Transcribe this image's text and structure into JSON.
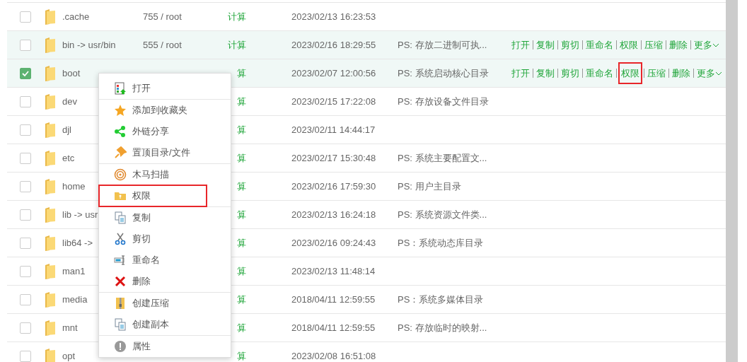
{
  "rows": [
    {
      "name": ".cache",
      "perms": "755 / root",
      "size": "计算",
      "date": "2023/02/13 16:23:53",
      "checked": false,
      "highlighted": false
    },
    {
      "name": "bin -> usr/bin",
      "perms": "555 / root",
      "size": "计算",
      "date": "2023/02/16 18:29:55",
      "note": "PS: 存放二进制可执...",
      "checked": false,
      "highlighted": true,
      "actions": [
        {
          "label": "打开",
          "marked": false
        },
        {
          "label": "复制",
          "marked": false
        },
        {
          "label": "剪切",
          "marked": false
        },
        {
          "label": "重命名",
          "marked": false
        },
        {
          "label": "权限",
          "marked": false
        },
        {
          "label": "压缩",
          "marked": false
        },
        {
          "label": "删除",
          "marked": false
        },
        {
          "label": "更多",
          "marked": false,
          "dropdown": true
        }
      ]
    },
    {
      "name": "boot",
      "size": "算",
      "date": "2023/02/07 12:00:56",
      "note": "PS: 系统启动核心目录",
      "checked": true,
      "highlighted": true,
      "actions": [
        {
          "label": "打开",
          "marked": false
        },
        {
          "label": "复制",
          "marked": false
        },
        {
          "label": "剪切",
          "marked": false
        },
        {
          "label": "重命名",
          "marked": false
        },
        {
          "label": "权限",
          "marked": true
        },
        {
          "label": "压缩",
          "marked": false
        },
        {
          "label": "删除",
          "marked": false
        },
        {
          "label": "更多",
          "marked": false,
          "dropdown": true
        }
      ]
    },
    {
      "name": "dev",
      "size": "算",
      "date": "2023/02/15 17:22:08",
      "note": "PS: 存放设备文件目录",
      "checked": false,
      "highlighted": false
    },
    {
      "name": "djl",
      "size": "算",
      "date": "2023/02/11 14:44:17",
      "checked": false,
      "highlighted": false
    },
    {
      "name": "etc",
      "size": "算",
      "date": "2023/02/17 15:30:48",
      "note": "PS: 系统主要配置文...",
      "checked": false,
      "highlighted": false
    },
    {
      "name": "home",
      "size": "算",
      "date": "2023/02/16 17:59:30",
      "note": "PS: 用户主目录",
      "checked": false,
      "highlighted": false
    },
    {
      "name": "lib -> usr",
      "size": "算",
      "date": "2023/02/13 16:24:18",
      "note": "PS: 系统资源文件类...",
      "checked": false,
      "highlighted": false
    },
    {
      "name": "lib64 ->",
      "size": "算",
      "date": "2023/02/16 09:24:43",
      "note": "PS：系统动态库目录",
      "checked": false,
      "highlighted": false
    },
    {
      "name": "man1",
      "size": "算",
      "date": "2023/02/13 11:48:14",
      "checked": false,
      "highlighted": false
    },
    {
      "name": "media",
      "size": "算",
      "date": "2018/04/11 12:59:55",
      "note": "PS：系统多媒体目录",
      "checked": false,
      "highlighted": false
    },
    {
      "name": "mnt",
      "size": "算",
      "date": "2018/04/11 12:59:55",
      "note": "PS: 存放临时的映射...",
      "checked": false,
      "highlighted": false
    },
    {
      "name": "opt",
      "size": "算",
      "date": "2023/02/08 16:51:08",
      "checked": false,
      "highlighted": false
    }
  ],
  "context_menu": {
    "groups": [
      [
        {
          "label": "打开",
          "marked": false
        }
      ],
      [
        {
          "label": "添加到收藏夹",
          "marked": false
        },
        {
          "label": "外链分享",
          "marked": false
        },
        {
          "label": "置顶目录/文件",
          "marked": false
        }
      ],
      [
        {
          "label": "木马扫描",
          "marked": false
        },
        {
          "label": "权限",
          "marked": true
        }
      ],
      [
        {
          "label": "复制",
          "marked": false
        },
        {
          "label": "剪切",
          "marked": false
        },
        {
          "label": "重命名",
          "marked": false
        },
        {
          "label": "删除",
          "marked": false
        }
      ],
      [
        {
          "label": "创建压缩",
          "marked": false
        },
        {
          "label": "创建副本",
          "marked": false
        }
      ],
      [
        {
          "label": "属性",
          "marked": false
        }
      ]
    ]
  }
}
